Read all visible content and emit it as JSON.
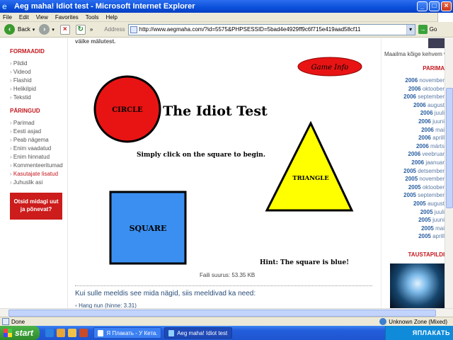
{
  "window": {
    "title": "Aeg maha! Idiot test - Microsoft Internet Explorer",
    "min": "_",
    "max": "□",
    "close": "×"
  },
  "menu": [
    "File",
    "Edit",
    "View",
    "Favorites",
    "Tools",
    "Help"
  ],
  "toolbar": {
    "back_label": "Back",
    "chevron": "»",
    "address_label": "Address",
    "url": "http://www.aegmaha.com/?id=5575&PHPSESSID=5bad4e4929ff9c6f715e419aad58cf11",
    "go_label": "Go"
  },
  "left": {
    "section1_title": "FORMAADID",
    "section1_items": [
      "Pildid",
      "Videod",
      "Flashid",
      "Helikilpid",
      "Tekstid"
    ],
    "section2_title": "PÄRINGUD",
    "section2_items": [
      "Parimad",
      "Eesti asjad",
      "Peab nägema",
      "Enim vaadatud",
      "Enim hinnatud",
      "Kommenteeritumad",
      "Kasutajate lisatud",
      "Juhuslik asi"
    ],
    "section2_highlight_index": 6,
    "ad_line1": "Otsid midagi uut",
    "ad_line2": "ja põnevat?"
  },
  "center": {
    "top_cut_text": "väike mälutest.",
    "game": {
      "game_info": "Game Info",
      "circle": "CIRCLE",
      "title": "The Idiot Test",
      "instruction": "Simply click on the square to begin.",
      "triangle": "TRIANGLE",
      "square": "SQUARE",
      "hint": "Hint: The square is blue!",
      "circle_color": "#e81414",
      "triangle_color": "#ffff00",
      "square_color": "#3b8ff0"
    },
    "file_size": "Faili suurus: 53.35 KB",
    "suggest": "Kui sulle meeldis see mida nägid, siis meeldivad ka need:",
    "first_link": "Hang nun (hinne: 3.31)"
  },
  "right": {
    "caption": "Maailma kõige kehvem varas",
    "best_title": "PARIMAD",
    "archive": [
      {
        "year": "2006",
        "month": "november"
      },
      {
        "year": "2006",
        "month": "oktoober"
      },
      {
        "year": "2006",
        "month": "september"
      },
      {
        "year": "2006",
        "month": "august"
      },
      {
        "year": "2006",
        "month": "juuli"
      },
      {
        "year": "2006",
        "month": "juuni"
      },
      {
        "year": "2006",
        "month": "mai"
      },
      {
        "year": "2006",
        "month": "aprill"
      },
      {
        "year": "2006",
        "month": "märts"
      },
      {
        "year": "2006",
        "month": "veebruar"
      },
      {
        "year": "2006",
        "month": "jaanuar"
      },
      {
        "year": "2005",
        "month": "detsember"
      },
      {
        "year": "2005",
        "month": "november"
      },
      {
        "year": "2005",
        "month": "oktoober"
      },
      {
        "year": "2005",
        "month": "september"
      },
      {
        "year": "2005",
        "month": "august"
      },
      {
        "year": "2005",
        "month": "juuli"
      },
      {
        "year": "2005",
        "month": "juuni"
      },
      {
        "year": "2005",
        "month": "mai"
      },
      {
        "year": "2005",
        "month": "aprill"
      }
    ],
    "wallpaper_title": "TAUSTAPILDID"
  },
  "status": {
    "text": "Done",
    "zone": "Unknown Zone (Mixed)"
  },
  "taskbar": {
    "start": "start",
    "task1": "Я Плакать - У Кета...",
    "task2": "Aeg maha! Idiot test ...",
    "watermark": "ЯПЛАКАТЬ"
  }
}
